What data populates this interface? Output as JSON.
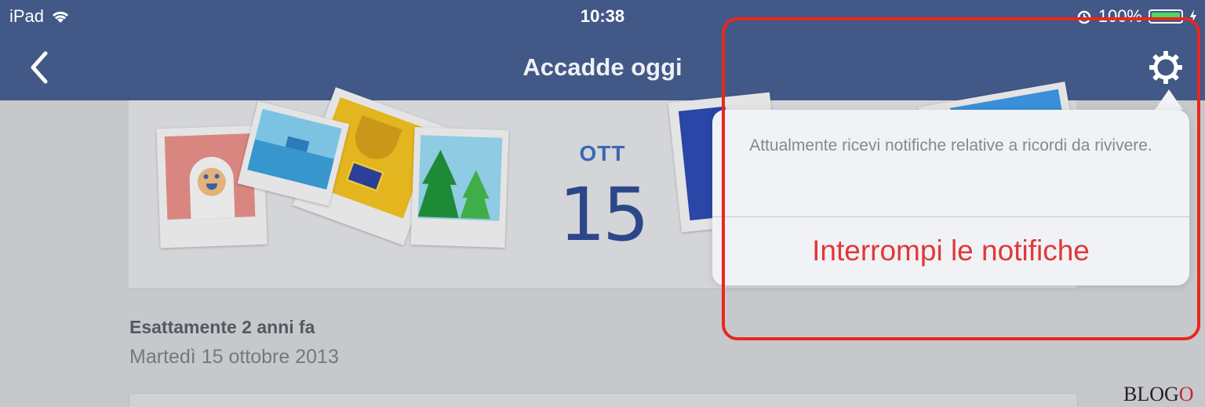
{
  "statusbar": {
    "device": "iPad",
    "time": "10:38",
    "battery_text": "100%",
    "battery_level": 1.0,
    "icons": [
      "wifi-icon",
      "alarm-icon",
      "battery-icon",
      "charging-icon"
    ]
  },
  "navbar": {
    "title": "Accadde oggi",
    "back_icon": "chevron-left-icon",
    "settings_icon": "gear-icon",
    "color": "#425887"
  },
  "banner": {
    "month": "OTT",
    "day": "15"
  },
  "memory": {
    "title": "Esattamente 2 anni fa",
    "date": "Martedì 15 ottobre 2013"
  },
  "popover": {
    "message": "Attualmente ricevi notifiche relative a ricordi da rivivere.",
    "action_label": "Interrompi le notifiche",
    "action_color": "#e0383a"
  },
  "watermark": {
    "text_main": "BLOG",
    "text_accent": "O"
  }
}
